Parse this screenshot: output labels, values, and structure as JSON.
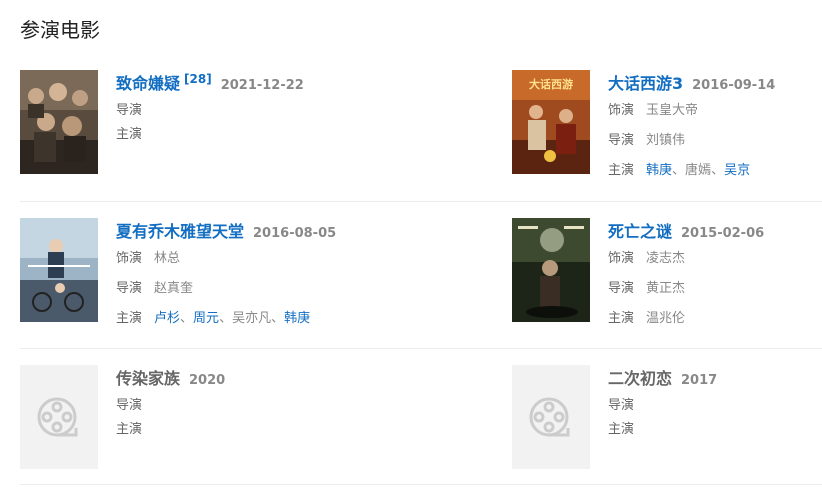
{
  "section": {
    "title": "参演电影"
  },
  "films": [
    {
      "title": "致命嫌疑",
      "badge": "[28]",
      "date": "2021-12-22",
      "roles": {
        "director_label": "导演",
        "cast_label": "主演"
      }
    },
    {
      "title": "大话西游3",
      "date": "2016-09-14",
      "roles": {
        "play_label": "饰演",
        "play_value": "玉皇大帝",
        "director_label": "导演",
        "director_value": "刘镇伟",
        "cast_label": "主演",
        "cast": [
          "韩庚",
          "唐嫣",
          "吴京"
        ],
        "cast_sep_1": "、",
        "cast_sep_2": "、"
      }
    },
    {
      "title": "夏有乔木雅望天堂",
      "date": "2016-08-05",
      "roles": {
        "play_label": "饰演",
        "play_value": "林总",
        "director_label": "导演",
        "director_value": "赵真奎",
        "cast_label": "主演",
        "cast": [
          "卢杉",
          "周元",
          "吴亦凡",
          "韩庚"
        ],
        "cast_sep": "、"
      }
    },
    {
      "title": "死亡之谜",
      "date": "2015-02-06",
      "roles": {
        "play_label": "饰演",
        "play_value": "凌志杰",
        "director_label": "导演",
        "director_value": "黄正杰",
        "cast_label": "主演",
        "cast_value": "温兆伦"
      }
    },
    {
      "title": "传染家族",
      "date": "2020",
      "roles": {
        "director_label": "导演",
        "cast_label": "主演"
      }
    },
    {
      "title": "二次初恋",
      "date": "2017",
      "roles": {
        "director_label": "导演",
        "cast_label": "主演"
      }
    }
  ],
  "poster_text": {
    "dahua": "大话西游"
  },
  "colors": {
    "link": "#136ec2",
    "muted": "#888888",
    "label": "#666666",
    "divider": "#ececec"
  }
}
